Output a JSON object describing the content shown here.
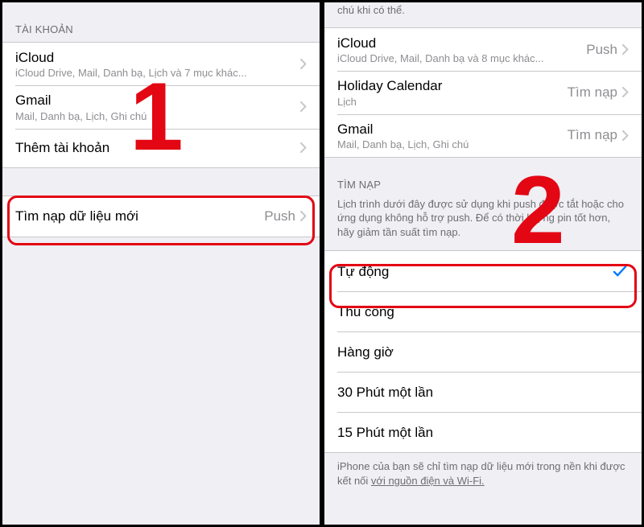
{
  "left": {
    "section_accounts": "TÀI KHOẢN",
    "accounts": [
      {
        "title": "iCloud",
        "subtitle": "iCloud Drive, Mail, Danh bạ, Lịch và 7 mục khác..."
      },
      {
        "title": "Gmail",
        "subtitle": "Mail, Danh bạ, Lịch, Ghi chú"
      },
      {
        "title": "Thêm tài khoản",
        "subtitle": ""
      }
    ],
    "fetch_row": {
      "title": "Tìm nạp dữ liệu mới",
      "value": "Push"
    },
    "step_number": "1"
  },
  "right": {
    "top_fragment": "chú khi có thể.",
    "accounts": [
      {
        "title": "iCloud",
        "subtitle": "iCloud Drive, Mail, Danh bạ và 8 mục khác...",
        "value": "Push"
      },
      {
        "title": "Holiday Calendar",
        "subtitle": "Lịch",
        "value": "Tìm nạp"
      },
      {
        "title": "Gmail",
        "subtitle": "Mail, Danh bạ, Lịch, Ghi chú",
        "value": "Tìm nạp"
      }
    ],
    "section_fetch": "TÌM NẠP",
    "fetch_description": "Lịch trình dưới đây được sử dụng khi push được tắt hoặc cho ứng dụng không hỗ trợ push. Để có thời lượng pin tốt hơn, hãy giảm tần suất tìm nạp.",
    "options": [
      {
        "label": "Tự động",
        "checked": true
      },
      {
        "label": "Thủ công",
        "checked": false
      },
      {
        "label": "Hàng giờ",
        "checked": false
      },
      {
        "label": "30 Phút một lần",
        "checked": false
      },
      {
        "label": "15 Phút một lần",
        "checked": false
      }
    ],
    "footer_a": "iPhone của bạn sẽ chỉ tìm nạp dữ liệu mới trong nền khi được kết nối ",
    "footer_b": "với nguồn điện và Wi-Fi.",
    "step_number": "2"
  }
}
